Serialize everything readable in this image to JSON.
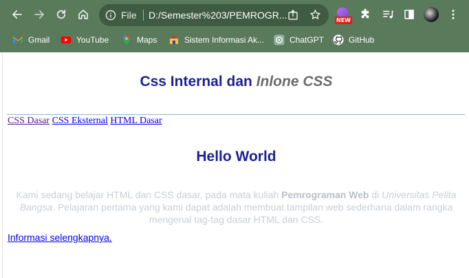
{
  "browser": {
    "omnibox": {
      "scheme_label": "File",
      "url": "D:/Semester%203/PEMROGR..."
    },
    "extension_badge": "NEW",
    "bookmarks": [
      {
        "label": "Gmail",
        "icon": "gmail-icon"
      },
      {
        "label": "YouTube",
        "icon": "youtube-icon"
      },
      {
        "label": "Maps",
        "icon": "maps-icon"
      },
      {
        "label": "Sistem Informasi Ak...",
        "icon": "sistem-informasi-icon"
      },
      {
        "label": "ChatGPT",
        "icon": "chatgpt-icon"
      },
      {
        "label": "GitHub",
        "icon": "github-icon"
      }
    ],
    "colors": {
      "frame": "#5a7a5c",
      "omnibox": "#3f5b41"
    }
  },
  "page": {
    "title_main": "Css Internal dan ",
    "title_italic": "Inlone CSS",
    "nav_links": [
      {
        "label": "CSS Dasar",
        "visited": true
      },
      {
        "label": "CSS Eksternal",
        "visited": false
      },
      {
        "label": "HTML Dasar",
        "visited": false
      }
    ],
    "heading": "Hello World",
    "paragraph": {
      "part1": "Kami sedang belajar HTML dan CSS dasar, pada mata kuliah ",
      "bold": "Pemrograman Web",
      "part2": " di ",
      "italic": "Universitas Pelita Bangsa",
      "part3": ". Pelajaran pertama yang kami dapat adalah membuat tampilan web sederhana dalam rangka mengenal tag-tag dasar HTML dan CSS."
    },
    "more_link": "Informasi selengkapnya.",
    "colors": {
      "heading": "#1a1f96",
      "paragraph": "#c9cfd6",
      "link": "#0000ee",
      "visited_link": "#551a8b"
    }
  }
}
